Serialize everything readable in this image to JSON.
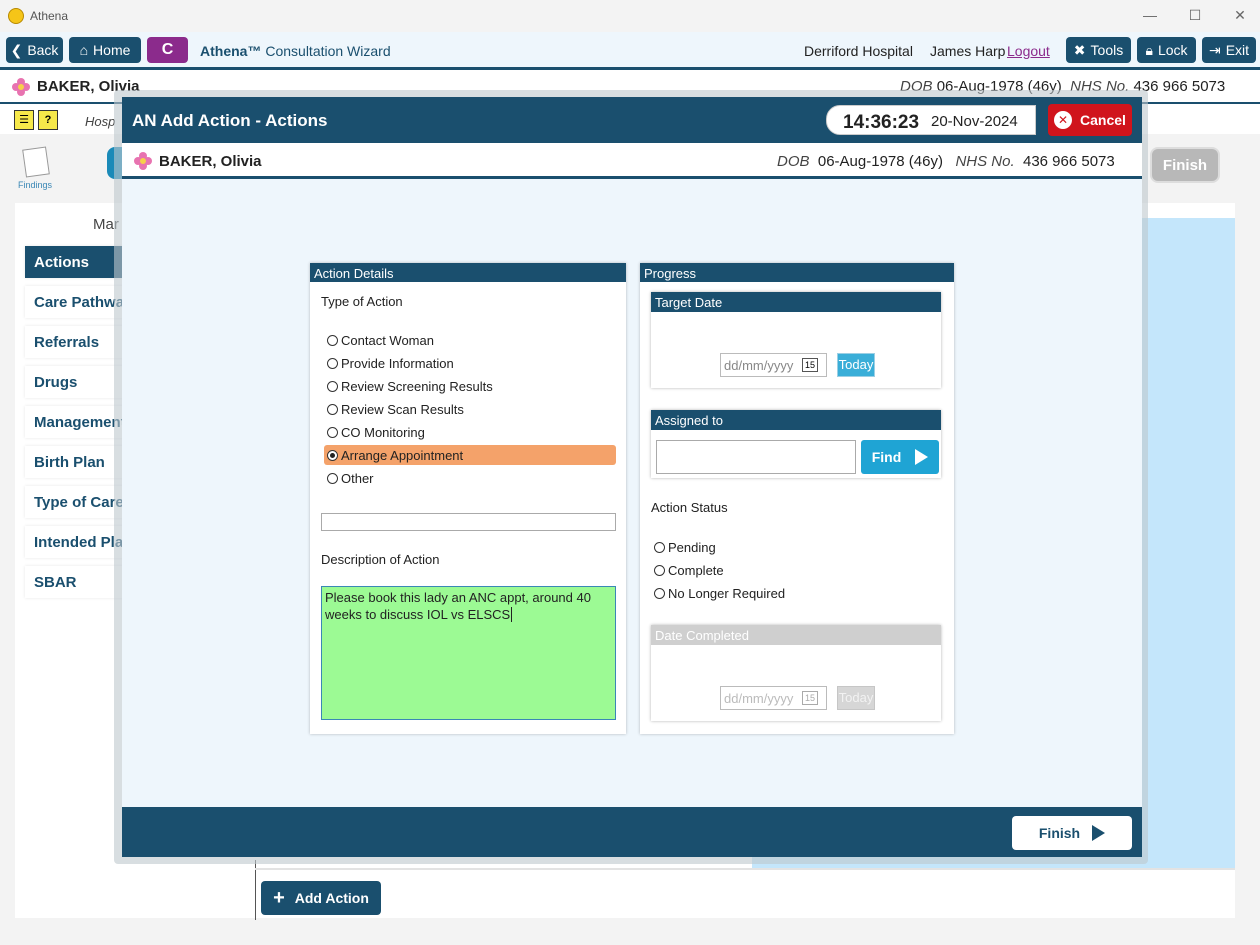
{
  "window": {
    "title": "Athena",
    "minimize": "—",
    "maximize": "☐",
    "close": "✕"
  },
  "toolbar": {
    "back": "Back",
    "home": "Home",
    "badge": "C",
    "wizard_brand": "Athena™",
    "wizard_title": "Consultation Wizard",
    "hospital": "Derriford Hospital",
    "user": "James Harp",
    "logout": "Logout",
    "tools": "Tools",
    "lock": "Lock",
    "exit": "Exit"
  },
  "patient": {
    "name": "BAKER, Olivia",
    "dob_label": "DOB",
    "dob": "06-Aug-1978 (46y)",
    "nhs_label": "NHS No.",
    "nhs": "436 966 5073"
  },
  "background": {
    "hosp_fragment": "Hosp",
    "findings_label": "Findings",
    "ma_fragment": "Mar",
    "finish": "Finish",
    "add_action": "Add Action",
    "sidebar": [
      {
        "label": "Actions",
        "active": true
      },
      {
        "label": "Care Pathway",
        "active": false
      },
      {
        "label": "Referrals",
        "active": false
      },
      {
        "label": "Drugs",
        "active": false
      },
      {
        "label": "Management",
        "active": false
      },
      {
        "label": "Birth Plan",
        "active": false
      },
      {
        "label": "Type of Care",
        "active": false
      },
      {
        "label": "Intended Place",
        "active": false
      },
      {
        "label": "SBAR",
        "active": false
      }
    ]
  },
  "modal": {
    "title": "AN Add Action - Actions",
    "time": "14:36:23",
    "date": "20-Nov-2024",
    "cancel": "Cancel",
    "finish": "Finish",
    "action_details": {
      "header": "Action Details",
      "type_label": "Type of Action",
      "options": [
        {
          "label": "Contact Woman",
          "selected": false
        },
        {
          "label": "Provide Information",
          "selected": false
        },
        {
          "label": "Review Screening Results",
          "selected": false
        },
        {
          "label": "Review Scan Results",
          "selected": false
        },
        {
          "label": "CO Monitoring",
          "selected": false
        },
        {
          "label": "Arrange Appointment",
          "selected": true
        },
        {
          "label": "Other",
          "selected": false
        }
      ],
      "other_value": "",
      "description_label": "Description of Action",
      "description": "Please book this lady an ANC appt, around 40 weeks to discuss IOL vs ELSCS"
    },
    "progress": {
      "header": "Progress",
      "target_date": {
        "header": "Target Date",
        "placeholder": "dd/mm/yyyy",
        "today": "Today"
      },
      "assigned_to": {
        "header": "Assigned to",
        "value": "",
        "find": "Find"
      },
      "status_label": "Action Status",
      "status_options": [
        {
          "label": "Pending",
          "selected": false
        },
        {
          "label": "Complete",
          "selected": false
        },
        {
          "label": "No Longer Required",
          "selected": false
        }
      ],
      "date_completed": {
        "header": "Date Completed",
        "placeholder": "dd/mm/yyyy",
        "today": "Today"
      },
      "calendar_day": "15"
    }
  }
}
